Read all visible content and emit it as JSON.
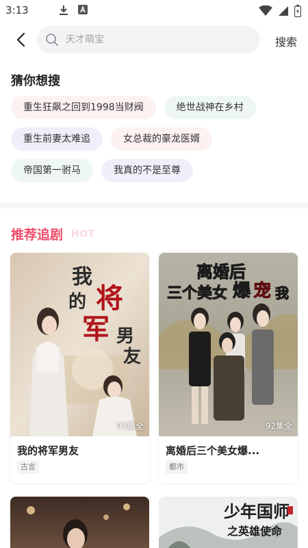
{
  "status": {
    "time": "3:13"
  },
  "search": {
    "placeholder": "天才萌宝",
    "button_label": "搜索"
  },
  "guess": {
    "title": "猜你想搜",
    "rows": [
      [
        {
          "label": "重生狂飙之回到1998当财阀",
          "tone": "pink"
        },
        {
          "label": "绝世战神在乡村",
          "tone": "mint"
        }
      ],
      [
        {
          "label": "重生前妻太难追",
          "tone": "lav"
        },
        {
          "label": "女总裁的豪龙医婿",
          "tone": "pink"
        }
      ],
      [
        {
          "label": "帝国第一驸马",
          "tone": "mint"
        },
        {
          "label": "我真的不是至尊",
          "tone": "lav"
        }
      ]
    ]
  },
  "recommend": {
    "title": "推荐追剧",
    "hot_label": "HOT",
    "cards": [
      {
        "title": "我的将军男友",
        "episodes": "93集全",
        "tag": "古言",
        "poster_text": "我的将军男友"
      },
      {
        "title": "离婚后三个美女爆...",
        "episodes": "92集全",
        "tag": "都市",
        "poster_text": "离婚后三个美女爆宠我"
      }
    ],
    "next_cards": [
      {
        "poster_text": ""
      },
      {
        "poster_text": "少年国师之英雄使命"
      }
    ]
  },
  "colors": {
    "accent": "#ef4e6a",
    "chip_pink": "#fdf1f2",
    "chip_mint": "#eef7f5",
    "chip_lavender": "#f0eff9"
  }
}
